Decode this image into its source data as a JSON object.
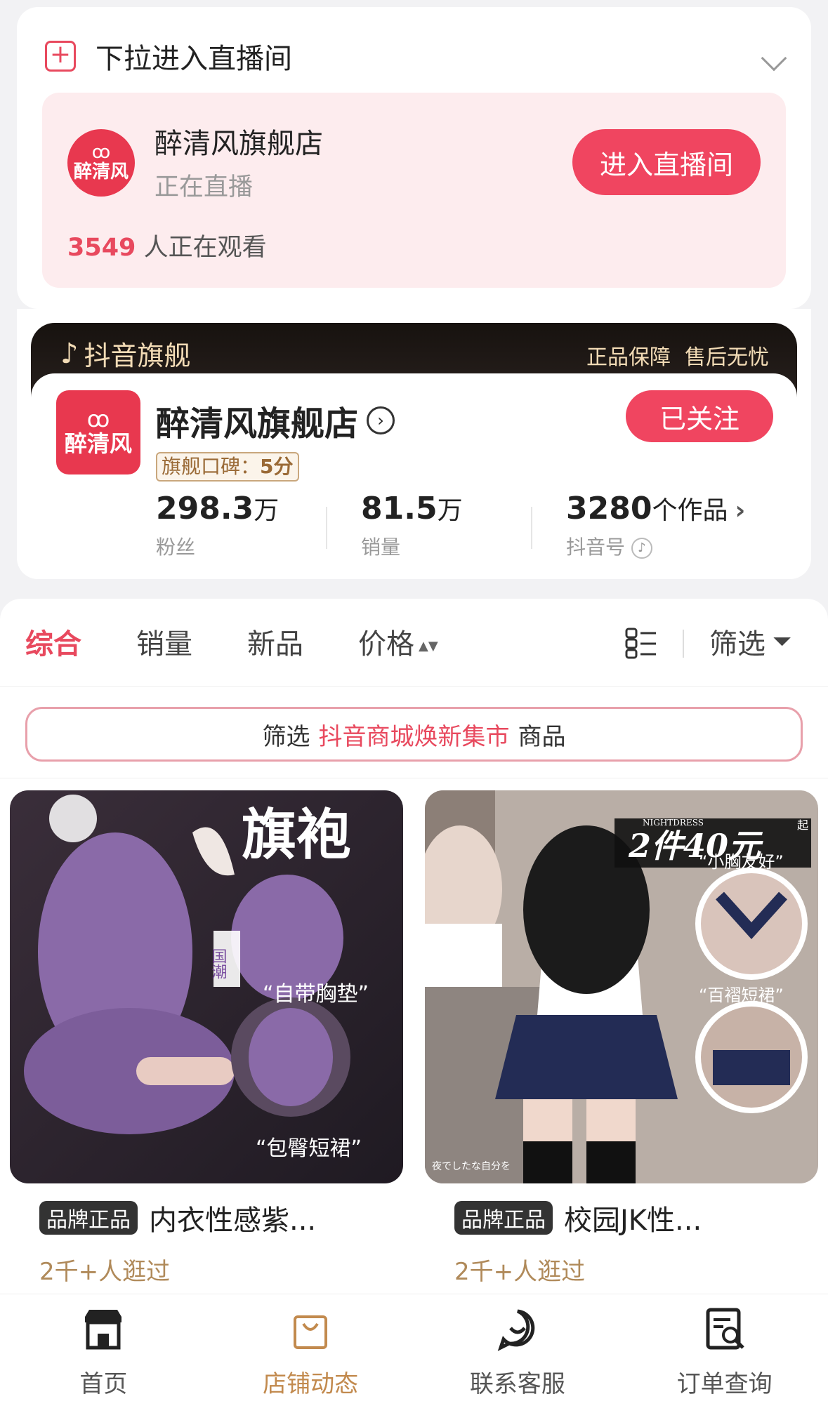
{
  "live": {
    "title": "下拉进入直播间",
    "store_name": "醉清风旗舰店",
    "status": "正在直播",
    "viewer_count": "3549",
    "viewer_suffix": "人正在观看",
    "enter_button": "进入直播间",
    "logo_text": "醉清风"
  },
  "store": {
    "flagship_label": "抖音旗舰",
    "guarantees": [
      "正品保障",
      "售后无忧"
    ],
    "name": "醉清风旗舰店",
    "logo_text": "醉清风",
    "rating_label": "旗舰口碑：",
    "rating_score": "5分",
    "follow_button": "已关注",
    "stats": {
      "fans": {
        "value": "298.3",
        "unit": "万",
        "label": "粉丝"
      },
      "sales": {
        "value": "81.5",
        "unit": "万",
        "label": "销量"
      },
      "works": {
        "value": "3280",
        "unit": "个作品",
        "label": "抖音号"
      }
    }
  },
  "tabs": {
    "items": [
      "综合",
      "销量",
      "新品",
      "价格"
    ],
    "filter": "筛选"
  },
  "market_banner": {
    "prefix": "筛选",
    "highlight": "抖音商城焕新集市",
    "suffix": "商品"
  },
  "products": [
    {
      "tag": "品牌正品",
      "title": "内衣性感紫...",
      "visits": "2千+人逛过",
      "image_text": {
        "headline": "旗袍",
        "side": "国潮",
        "point1": "“自带胸垫”",
        "point2": "“包臀短裙”"
      }
    },
    {
      "tag": "品牌正品",
      "title": "校园JK性...",
      "visits": "2千+人逛过",
      "image_text": {
        "headline": "2件40元",
        "badge": "起",
        "small": "NIGHTDRESS",
        "point1": "“小胸友好”",
        "point2": "“百褶短裙”",
        "caption": "夜でしたな自分を"
      }
    }
  ],
  "nav": {
    "items": [
      {
        "label": "首页",
        "icon": "store-icon"
      },
      {
        "label": "店铺动态",
        "icon": "shopping-bag-icon"
      },
      {
        "label": "联系客服",
        "icon": "chat-icon"
      },
      {
        "label": "订单查询",
        "icon": "order-search-icon"
      }
    ],
    "active": "店铺动态"
  },
  "colors": {
    "accent": "#f04560",
    "gold": "#f3dcb6",
    "nav_active": "#c28a4e"
  }
}
